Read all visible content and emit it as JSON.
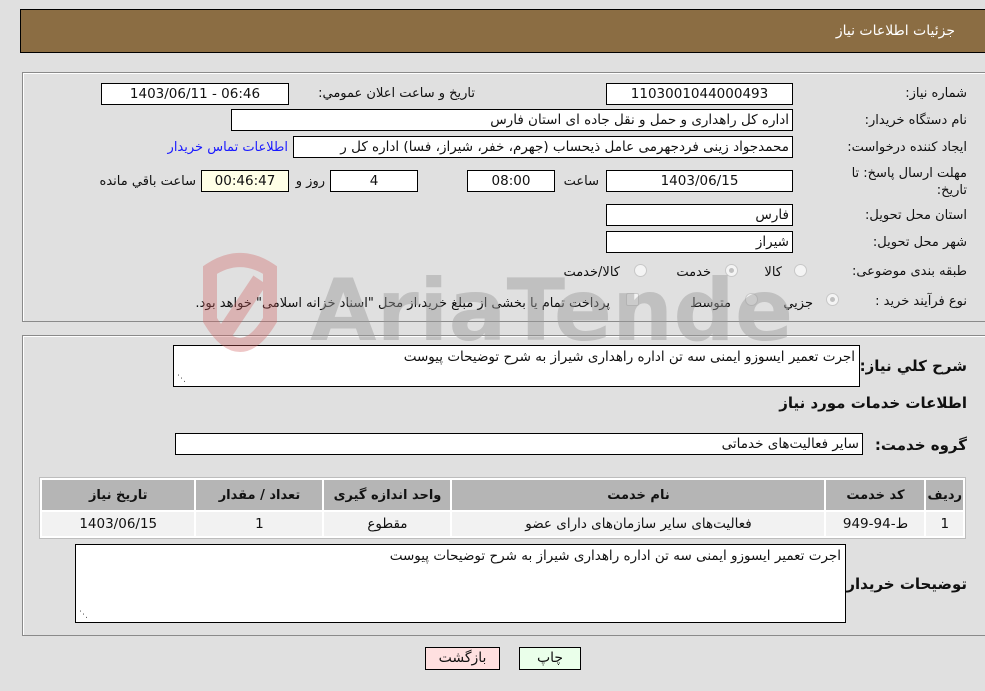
{
  "header": {
    "title": "جزئیات اطلاعات نیاز"
  },
  "need_info": {
    "need_number_label": "شماره نیاز:",
    "need_number": "1103001044000493",
    "announce_label": "تاریخ و ساعت اعلان عمومي:",
    "announce_value": "1403/06/11 - 06:46",
    "buyer_org_label": "نام دستگاه خریدار:",
    "buyer_org": "اداره کل راهداری و حمل و نقل جاده ای استان فارس",
    "requester_label": "ایجاد کننده درخواست:",
    "requester": "محمدجواد زینی فردجهرمی عامل ذیحساب (جهرم، خفر، شیراز، فسا) اداره کل ر",
    "contact_link": "اطلاعات تماس خریدار",
    "deadline_label_line1": "مهلت ارسال پاسخ: تا",
    "deadline_label_line2": "تاریخ:",
    "deadline_date": "1403/06/15",
    "time_label": "ساعت",
    "deadline_time": "08:00",
    "days_value": "4",
    "days_label": "روز و",
    "remaining_time": "00:46:47",
    "remaining_label": "ساعت باقي مانده",
    "province_label": "استان محل تحویل:",
    "province": "فارس",
    "city_label": "شهر محل تحویل:",
    "city": "شیراز",
    "category_label": "طبقه بندی موضوعی:",
    "category_options": [
      {
        "label": "کالا",
        "checked": false
      },
      {
        "label": "خدمت",
        "checked": true
      },
      {
        "label": "کالا/خدمت",
        "checked": false
      }
    ],
    "process_label": "نوع فرآیند خرید :",
    "process_options": [
      {
        "label": "جزيي",
        "checked": true
      },
      {
        "label": "متوسط",
        "checked": false
      }
    ],
    "treasury_note": "پرداخت تمام یا بخشی از مبلغ خرید،از محل \"اسناد خزانه اسلامی\" خواهد بود."
  },
  "details": {
    "summary_label": "شرح کلي نیاز:",
    "summary": "اجرت تعمیر ایسوزو ایمنی سه تن اداره راهداری شیراز به شرح توضیحات پیوست",
    "services_heading": "اطلاعات خدمات مورد نیاز",
    "service_group_label": "گروه خدمت:",
    "service_group": "سایر فعالیت‌های خدماتی",
    "table": {
      "headers": [
        "ردیف",
        "کد خدمت",
        "نام خدمت",
        "واحد اندازه گیری",
        "تعداد / مقدار",
        "تاریخ نیاز"
      ],
      "rows": [
        [
          "1",
          "ط-94-949",
          "فعالیت‌های سایر سازمان‌های دارای عضو",
          "مقطوع",
          "1",
          "1403/06/15"
        ]
      ]
    },
    "buyer_notes_label": "توضیحات خریدار:",
    "buyer_notes": "اجرت تعمیر ایسوزو ایمنی سه تن اداره راهداری شیراز به شرح توضیحات پیوست"
  },
  "buttons": {
    "print": "چاپ",
    "back": "بازگشت"
  },
  "watermark": {
    "text": "AriaTender.neT"
  }
}
